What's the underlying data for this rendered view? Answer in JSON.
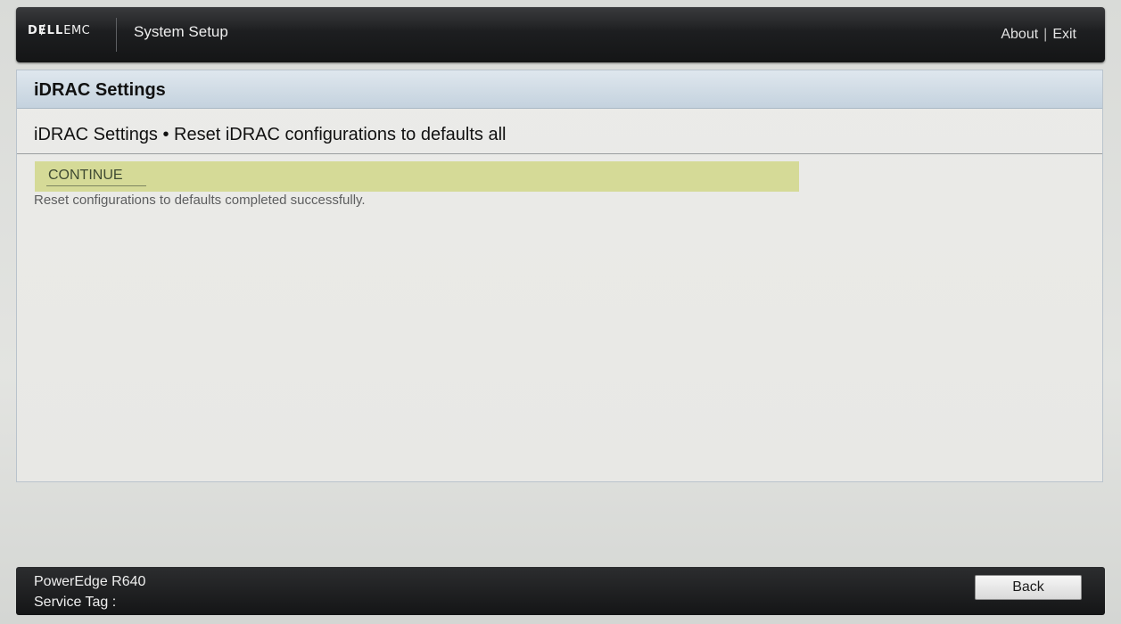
{
  "header": {
    "logo_dell": "DɆLL",
    "logo_emc": "EMC",
    "title": "System Setup",
    "about_label": "About",
    "separator": "|",
    "exit_label": "Exit"
  },
  "panel": {
    "title": "iDRAC Settings",
    "breadcrumb": "iDRAC Settings • Reset iDRAC configurations to defaults all",
    "continue_label": "CONTINUE",
    "status_message": "Reset configurations to defaults completed successfully."
  },
  "footer": {
    "model": "PowerEdge R640",
    "service_tag_label": "Service Tag :",
    "back_label": "Back"
  },
  "colors": {
    "header_bg": "#1d1e20",
    "title_bar": "#c4d2de",
    "continue_highlight": "#d5da97",
    "panel_bg": "#ebebe8"
  }
}
